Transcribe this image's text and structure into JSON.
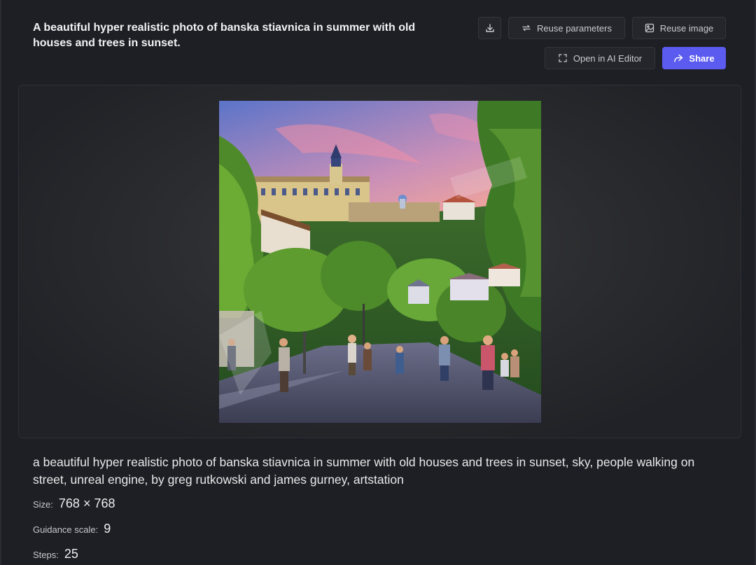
{
  "header": {
    "title": "A beautiful hyper realistic photo of banska stiavnica in summer with old houses and trees in sunset."
  },
  "toolbar": {
    "download_icon": "download-icon",
    "reuse_parameters_label": "Reuse parameters",
    "reuse_image_label": "Reuse image",
    "open_editor_label": "Open in AI Editor",
    "share_label": "Share"
  },
  "image": {
    "alt": "Generated image: banska stiavnica town in summer at sunset with people walking on a cobblestone street"
  },
  "details": {
    "prompt": "a beautiful hyper realistic photo of banska stiavnica in summer with old houses and trees in sunset, sky, people walking on street, unreal engine, by greg rutkowski and james gurney, artstation",
    "size_label": "Size:",
    "size_value": "768 × 768",
    "guidance_label": "Guidance scale:",
    "guidance_value": "9",
    "steps_label": "Steps:",
    "steps_value": "25"
  },
  "colors": {
    "accent": "#5b5bf0",
    "background": "#1e1f24",
    "panel": "#2c2d30"
  }
}
